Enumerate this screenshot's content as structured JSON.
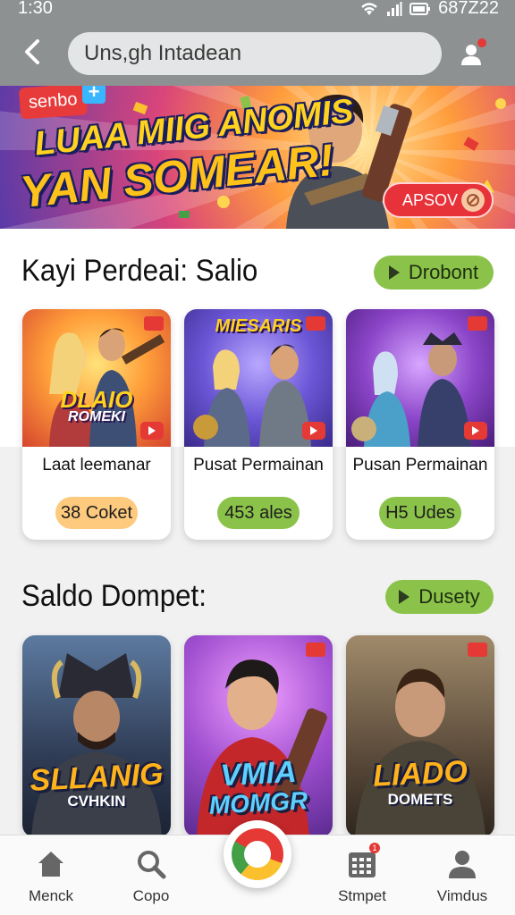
{
  "status_bar": {
    "time": "1:30",
    "battery_text": "687Z22"
  },
  "header": {
    "search_value": "Uns,gh Intadean"
  },
  "banner": {
    "tag": "senbo",
    "plus": "+",
    "headline_1": "LUAA MIIG ANOMIS",
    "headline_2": "YAN SOMEAR!",
    "cta_label": "APSOV"
  },
  "section1": {
    "title": "Kayi Perdeai: Salio",
    "action_label": "Drobont",
    "cards": [
      {
        "art_text_1": "DLAIO",
        "art_text_2": "ROMEKI",
        "name": "Laat leemanar",
        "chip": "38 Coket",
        "chip_style": "orange"
      },
      {
        "art_text_1": "MIESARIS",
        "art_text_2": "",
        "name": "Pusat Permainan",
        "chip": "453 ales",
        "chip_style": "green"
      },
      {
        "art_text_1": "",
        "art_text_2": "",
        "name": "Pusan Permainan",
        "chip": "H5 Udes",
        "chip_style": "green"
      }
    ]
  },
  "section2": {
    "title": "Saldo Dompet:",
    "action_label": "Dusety",
    "cards": [
      {
        "art_text_1": "SLLANIG",
        "art_text_2": "CVHKIN"
      },
      {
        "art_text_1": "VMIA",
        "art_text_2": "MOMGR"
      },
      {
        "art_text_1": "LIADO",
        "art_text_2": "DOMETS"
      }
    ]
  },
  "bottom_nav": {
    "items": [
      {
        "label": "Menck",
        "icon": "home-icon"
      },
      {
        "label": "Copo",
        "icon": "search-icon"
      },
      {
        "label": "Stmpet",
        "icon": "calendar-icon",
        "badge": "1"
      },
      {
        "label": "Vimdus",
        "icon": "person-icon"
      }
    ],
    "center_icon": "ring-logo-icon"
  },
  "colors": {
    "header_bg": "#8e9192",
    "accent_green": "#8bc34a",
    "accent_orange": "#fdca7e",
    "accent_red": "#e53935"
  }
}
